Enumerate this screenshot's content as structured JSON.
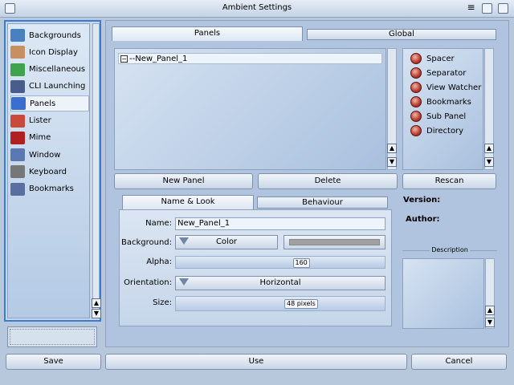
{
  "window": {
    "title": "Ambient Settings"
  },
  "sidebar": {
    "items": [
      {
        "label": "Backgrounds",
        "icon": "backgrounds-icon",
        "color": "#4a7fc0"
      },
      {
        "label": "Icon Display",
        "icon": "icon-display-icon",
        "color": "#c89060"
      },
      {
        "label": "Miscellaneous",
        "icon": "miscellaneous-icon",
        "color": "#3fa34d"
      },
      {
        "label": "CLI Launching",
        "icon": "cli-launching-icon",
        "color": "#4a5d8a"
      },
      {
        "label": "Panels",
        "icon": "panels-icon",
        "color": "#3a6fd0",
        "selected": true
      },
      {
        "label": "Lister",
        "icon": "lister-icon",
        "color": "#c94a3a"
      },
      {
        "label": "Mime",
        "icon": "mime-icon",
        "color": "#b02020"
      },
      {
        "label": "Window",
        "icon": "window-icon",
        "color": "#5a79b0"
      },
      {
        "label": "Keyboard",
        "icon": "keyboard-icon",
        "color": "#777777"
      },
      {
        "label": "Bookmarks",
        "icon": "bookmarks-icon",
        "color": "#5a6fa0"
      }
    ]
  },
  "tabs": {
    "panels": "Panels",
    "global": "Global"
  },
  "tree": {
    "root": "New_Panel_1",
    "connector": "--"
  },
  "palette": {
    "items": [
      "Spacer",
      "Separator",
      "View Watcher",
      "Bookmarks",
      "Sub Panel",
      "Directory"
    ]
  },
  "actions": {
    "new_panel": "New Panel",
    "delete": "Delete",
    "rescan": "Rescan"
  },
  "subtabs": {
    "name_look": "Name & Look",
    "behaviour": "Behaviour"
  },
  "form": {
    "name_label": "Name:",
    "name_value": "New_Panel_1",
    "background_label": "Background:",
    "background_value": "Color",
    "alpha_label": "Alpha:",
    "alpha_value": "160",
    "alpha_fraction": 0.6,
    "orientation_label": "Orientation:",
    "orientation_value": "Horizontal",
    "size_label": "Size:",
    "size_value": "48 pixels",
    "size_fraction": 0.6,
    "swatch_color": "#a0a0a0"
  },
  "meta": {
    "version_label": "Version:",
    "author_label": "Author:",
    "description_label": "Description"
  },
  "bottom": {
    "save": "Save",
    "use": "Use",
    "cancel": "Cancel"
  }
}
